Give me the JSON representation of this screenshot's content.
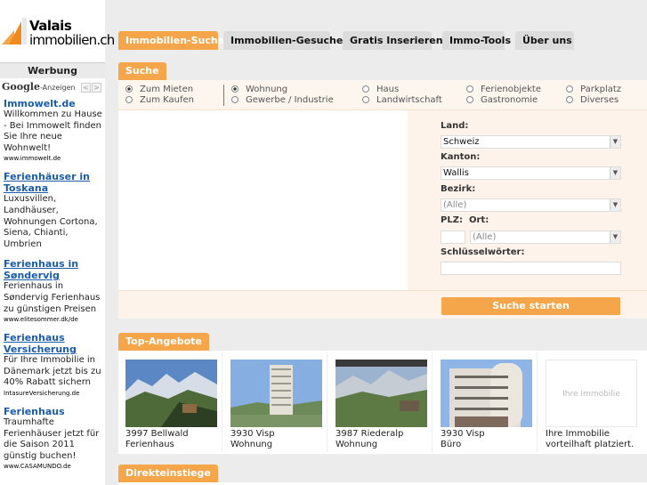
{
  "logo": {
    "line1": "Valais",
    "line2": "immobilien.ch",
    "accent": "#f5a54a"
  },
  "sidebar": {
    "ad_heading": "Werbung",
    "google_label": "Google",
    "google_sub": "-Anzeigen",
    "ads": [
      {
        "title": "Immowelt.de",
        "desc": "Willkommen zu Hause - Bei Immowelt finden Sie Ihre neue Wohnwelt!",
        "url": "www.immowelt.de"
      },
      {
        "title": "Ferienhäuser in Toskana",
        "desc": "Luxusvillen, Landhäuser, Wohnungen Cortona, Siena, Chianti, Umbrien",
        "url": ""
      },
      {
        "title": "Ferienhaus in Søndervig",
        "desc": "Ferienhaus in Søndervig Ferienhaus zu günstigen Preisen",
        "url": "www.elitesommer.dk/de"
      },
      {
        "title": "Ferienhaus Versicherung",
        "desc": "Für Ihre Immobilie in Dänemark jetzt bis zu 40% Rabatt sichern",
        "url": "IntasureVersicherung.de"
      },
      {
        "title": "Ferienhaus",
        "desc": "Traumhafte Ferienhäuser jetzt für die Saison 2011 günstig buchen!",
        "url": "www.CASAMUNDO.de"
      }
    ]
  },
  "nav": {
    "tabs": [
      "Immobilien-Suche",
      "Immobilien-Gesuche",
      "Gratis Inserieren",
      "Immo-Tools",
      "Über uns"
    ]
  },
  "search": {
    "title": "Suche",
    "mode": [
      "Zum Mieten",
      "Zum Kaufen"
    ],
    "types": [
      "Wohnung",
      "Gewerbe / Industrie",
      "Haus",
      "Landwirtschaft",
      "Ferienobjekte",
      "Gastronomie",
      "Parkplatz",
      "Diverses"
    ],
    "land_label": "Land:",
    "land_value": "Schweiz",
    "kanton_label": "Kanton:",
    "kanton_value": "Wallis",
    "bezirk_label": "Bezirk:",
    "bezirk_value": "(Alle)",
    "plz_label": "PLZ:",
    "ort_label": "Ort:",
    "ort_value": "(Alle)",
    "keywords_label": "Schlüsselwörter:",
    "submit": "Suche starten"
  },
  "top": {
    "title": "Top-Angebote",
    "items": [
      {
        "l1": "3997 Bellwald",
        "l2": "Ferienhaus"
      },
      {
        "l1": "3930 Visp",
        "l2": "Wohnung"
      },
      {
        "l1": "3987 Riederalp",
        "l2": "Wohnung"
      },
      {
        "l1": "3930 Visp",
        "l2": "Büro"
      },
      {
        "placeholder": "Ihre Immobilie",
        "l1": "Ihre Immobilie",
        "l2": "vorteilhaft platziert."
      }
    ]
  },
  "direkt": {
    "title": "Direkteinstiege"
  }
}
